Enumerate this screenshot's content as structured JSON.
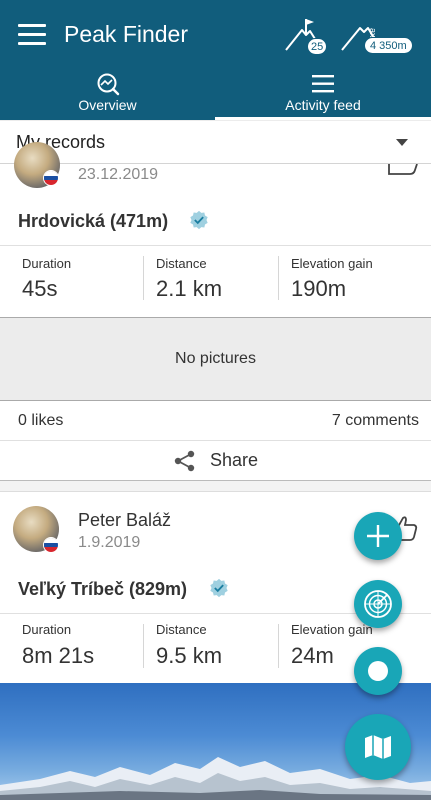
{
  "app": {
    "title": "Peak Finder",
    "colors": {
      "primary": "#115d7c",
      "accent": "#19a6b7",
      "background": "#ececec"
    },
    "peaks_count": "25",
    "max_elevation": "4 350m"
  },
  "tabs": [
    {
      "label": "Overview",
      "icon": "overview-icon",
      "active": false
    },
    {
      "label": "Activity feed",
      "icon": "feed-icon",
      "active": true
    }
  ],
  "filter": {
    "selected": "My records"
  },
  "activities": [
    {
      "date": "23.12.2019",
      "peak": "Hrdovická (471m)",
      "verified": true,
      "stats": [
        {
          "label": "Duration",
          "value": "45s"
        },
        {
          "label": "Distance",
          "value": "2.1 km"
        },
        {
          "label": "Elevation gain",
          "value": "190m"
        }
      ],
      "pictures_text": "No pictures",
      "likes": "0 likes",
      "comments": "7 comments",
      "share_label": "Share"
    },
    {
      "user": "Peter Baláž",
      "date": "1.9.2019",
      "peak": "Veľký Tríbeč (829m)",
      "verified": true,
      "stats": [
        {
          "label": "Duration",
          "value": "8m 21s"
        },
        {
          "label": "Distance",
          "value": "9.5 km"
        },
        {
          "label": "Elevation gain",
          "value": "24m"
        }
      ]
    }
  ],
  "fabs": [
    {
      "icon": "plus-icon"
    },
    {
      "icon": "radar-icon"
    },
    {
      "icon": "record-icon"
    },
    {
      "icon": "map-icon"
    }
  ]
}
